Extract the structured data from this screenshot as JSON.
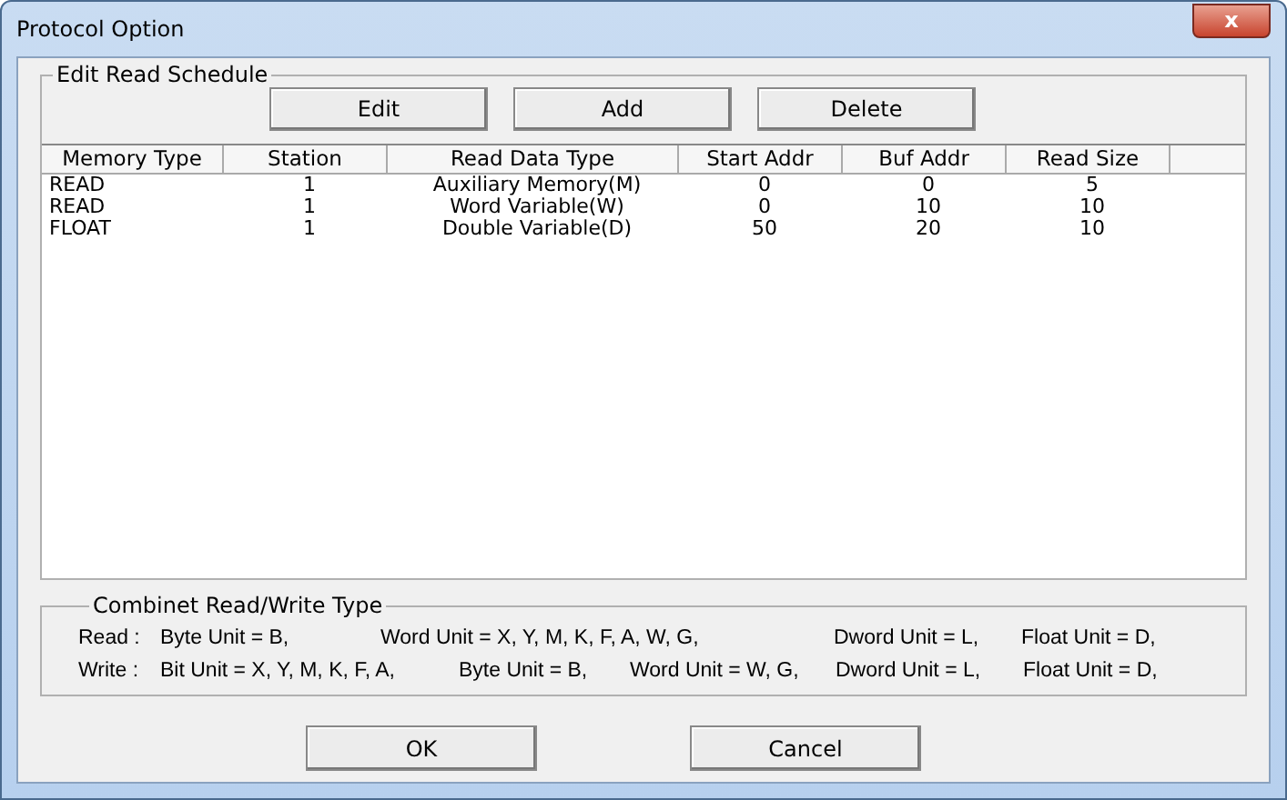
{
  "window": {
    "title": "Protocol Option",
    "close": "x"
  },
  "schedule": {
    "title": "Edit Read Schedule",
    "buttons": [
      "Edit",
      "Add",
      "Delete"
    ],
    "columns": [
      "Memory Type",
      "Station",
      "Read Data Type",
      "Start Addr",
      "Buf Addr",
      "Read Size"
    ],
    "rows": [
      [
        "READ",
        "1",
        "Auxiliary Memory(M)",
        "0",
        "0",
        "5"
      ],
      [
        "READ",
        "1",
        "Word Variable(W)",
        "0",
        "10",
        "10"
      ],
      [
        "FLOAT",
        "1",
        "Double Variable(D)",
        "50",
        "20",
        "10"
      ]
    ]
  },
  "types": {
    "title": "Combinet Read/Write Type",
    "lines": [
      {
        "label": "Read :",
        "units": [
          "Byte Unit = B,",
          "Word Unit = X, Y, M, K, F, A, W, G,",
          "Dword Unit = L,",
          "Float Unit = D,"
        ]
      },
      {
        "label": "Write :",
        "units": [
          "Bit Unit = X, Y, M, K, F, A,",
          "Byte Unit = B,",
          "Word Unit = W, G,",
          "Dword Unit = L,",
          "Float Unit = D,"
        ]
      }
    ]
  },
  "buttons": [
    "OK",
    "Cancel"
  ]
}
